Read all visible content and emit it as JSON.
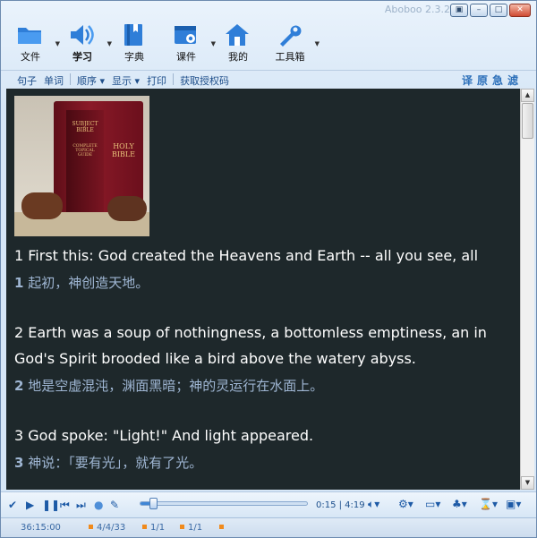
{
  "window": {
    "title": "Aboboo 2.3.2",
    "buttons": [
      "▣",
      "–",
      "□",
      "✕"
    ]
  },
  "toolbar": {
    "items": [
      {
        "label": "文件",
        "icon": "folder-icon",
        "has_dropdown": true
      },
      {
        "label": "学习",
        "icon": "speaker-icon",
        "has_dropdown": true
      },
      {
        "label": "字典",
        "icon": "book-icon",
        "has_dropdown": false
      },
      {
        "label": "课件",
        "icon": "courseware-icon",
        "has_dropdown": true
      },
      {
        "label": "我的",
        "icon": "home-icon",
        "has_dropdown": false
      },
      {
        "label": "工具箱",
        "icon": "wrench-icon",
        "has_dropdown": true
      }
    ]
  },
  "subbar": {
    "sentence": "句子",
    "word": "单词",
    "order": "顺序",
    "display": "显示",
    "print": "打印",
    "license": "获取授权码",
    "right_ops": [
      "译",
      "原",
      "急",
      "滤"
    ]
  },
  "content": {
    "image_text": {
      "spine": "SUBJECT BIBLE",
      "cover": "HOLY BIBLE",
      "sub": "COMPLETE TOPICAL GUIDE"
    },
    "verses": [
      {
        "en": "1 First this: God created the Heavens and Earth -- all you see, all",
        "cn_num": "1",
        "cn": " 起初，神创造天地。"
      },
      {
        "en": "2 Earth was a soup of nothingness, a bottomless emptiness, an in",
        "en2": "God's Spirit brooded like a bird above the watery abyss.",
        "cn_num": "2",
        "cn": " 地是空虚混沌，渊面黑暗；神的灵运行在水面上。"
      },
      {
        "en": "3 God spoke: \"Light!\" And light appeared.",
        "cn_num": "3",
        "cn": " 神说：「要有光」，就有了光。"
      }
    ]
  },
  "player": {
    "time": "0:15 | 4:19",
    "progress": 0.058
  },
  "status": {
    "clock": "36:15:00",
    "position": "4/4/33",
    "page1": "1/1",
    "page2": "1/1"
  }
}
